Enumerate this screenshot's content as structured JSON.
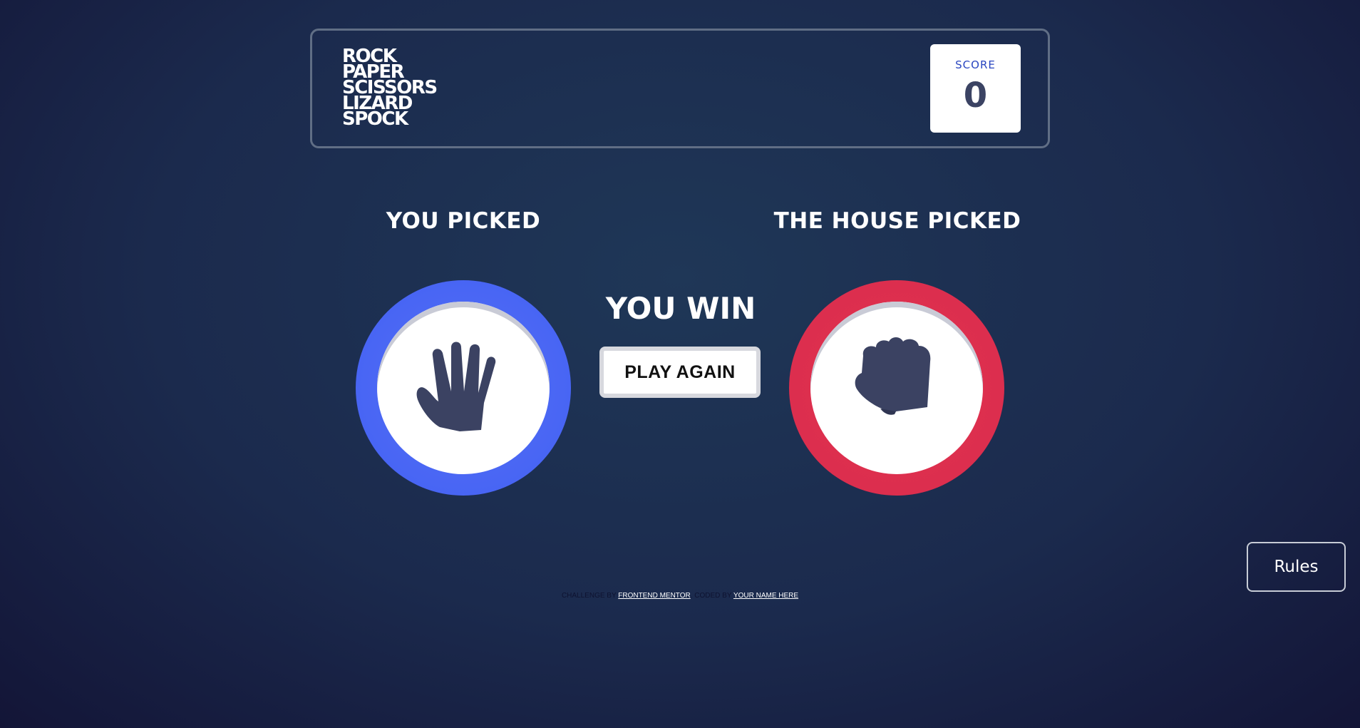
{
  "header": {
    "logo_lines": [
      "ROCK",
      "PAPER",
      "SCISSORS",
      "LIZARD",
      "SPOCK"
    ],
    "score_label": "SCORE",
    "score_value": "0"
  },
  "player": {
    "title": "YOU PICKED",
    "choice": "paper",
    "icon": "paper-hand-icon",
    "ring_color": "#4865f4"
  },
  "house": {
    "title": "THE HOUSE PICKED",
    "choice": "rock",
    "icon": "rock-fist-icon",
    "ring_color": "#dc2e4e"
  },
  "result": {
    "message": "YOU WIN",
    "play_again_label": "PLAY AGAIN"
  },
  "attribution": {
    "prefix": "CHALLENGE BY",
    "link1": "FRONTEND MENTOR",
    "middle": ". CODED BY",
    "link2": "YOUR NAME HERE"
  },
  "rules_button": {
    "label": "Rules"
  }
}
